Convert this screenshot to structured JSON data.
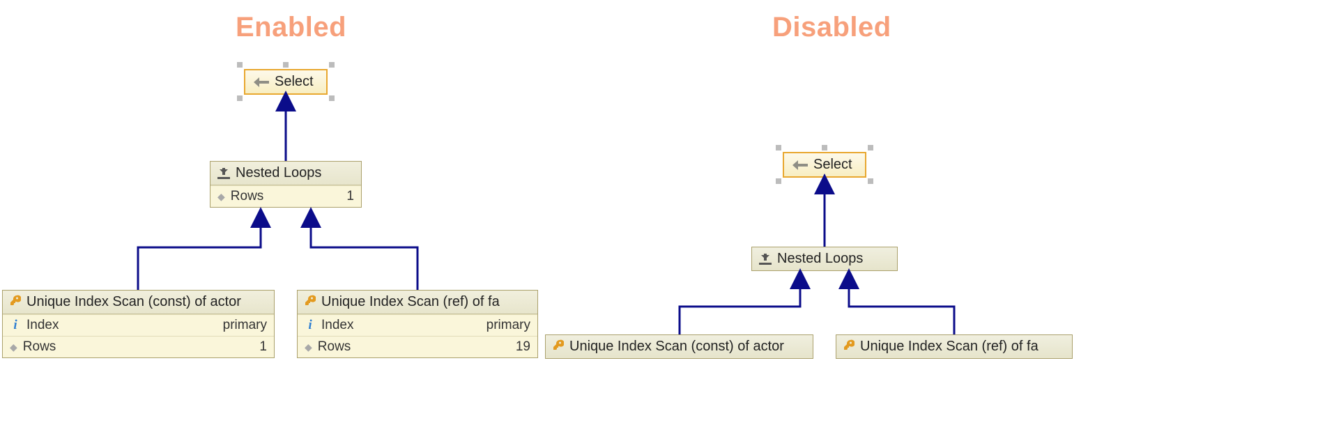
{
  "left": {
    "heading": "Enabled",
    "select": {
      "label": "Select"
    },
    "nested": {
      "label": "Nested Loops",
      "rows_label": "Rows",
      "rows_value": "1"
    },
    "scan_a": {
      "label": "Unique Index Scan (const) of actor",
      "index_label": "Index",
      "index_value": "primary",
      "rows_label": "Rows",
      "rows_value": "1"
    },
    "scan_b": {
      "label": "Unique Index Scan (ref) of fa",
      "index_label": "Index",
      "index_value": "primary",
      "rows_label": "Rows",
      "rows_value": "19"
    }
  },
  "right": {
    "heading": "Disabled",
    "select": {
      "label": "Select"
    },
    "nested": {
      "label": "Nested Loops"
    },
    "scan_a": {
      "label": "Unique Index Scan (const) of actor"
    },
    "scan_b": {
      "label": "Unique Index Scan (ref) of fa"
    }
  },
  "colors": {
    "heading": "#f7a07b",
    "select_border": "#e8a72f",
    "arrow": "#0b0c8a"
  }
}
